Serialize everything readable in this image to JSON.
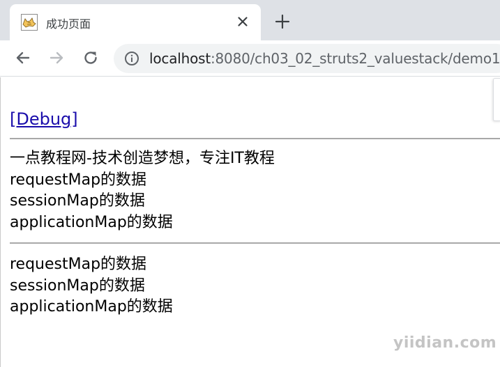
{
  "tab": {
    "title": "成功页面",
    "favicon": "tomcat-icon"
  },
  "toolbar": {
    "back_icon": "arrow-left-icon",
    "forward_icon": "arrow-right-icon",
    "reload_icon": "reload-icon"
  },
  "address_bar": {
    "host": "localhost",
    "path": ":8080/ch03_02_struts2_valuestack/demo1"
  },
  "page": {
    "debug_link": "[Debug]",
    "section1": [
      "一点教程网-技术创造梦想，专注IT教程",
      "requestMap的数据",
      "sessionMap的数据",
      "applicationMap的数据"
    ],
    "section2": [
      "requestMap的数据",
      "sessionMap的数据",
      "applicationMap的数据"
    ]
  },
  "watermark": "yiidian.com",
  "colors": {
    "tabstrip": "#dee1e6",
    "link": "#1a0dab",
    "omnibox": "#f1f3f4"
  }
}
